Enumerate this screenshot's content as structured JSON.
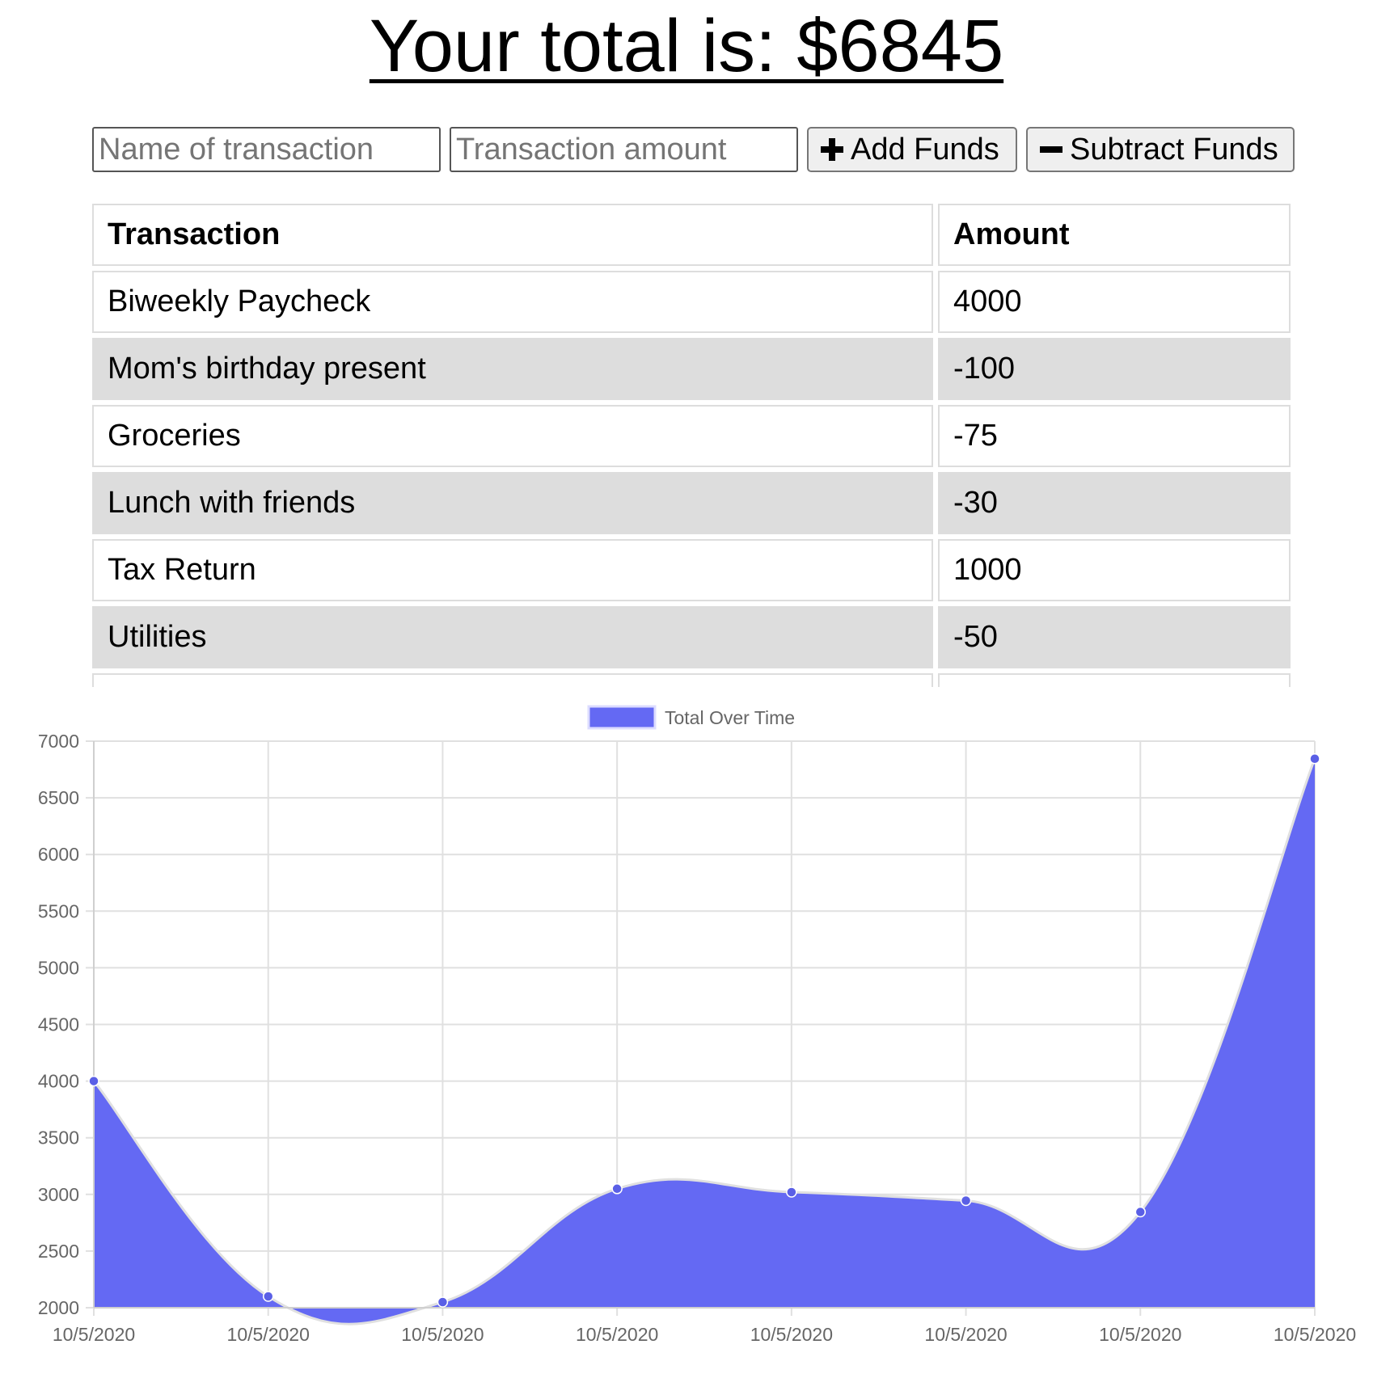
{
  "header": {
    "total_text": "Your total is: $6845"
  },
  "form": {
    "name_placeholder": "Name of transaction",
    "amount_placeholder": "Transaction amount",
    "add_label": "Add Funds",
    "subtract_label": "Subtract Funds"
  },
  "table": {
    "headers": [
      "Transaction",
      "Amount"
    ],
    "rows": [
      {
        "name": "Biweekly Paycheck",
        "amount": "4000"
      },
      {
        "name": "Mom's birthday present",
        "amount": "-100"
      },
      {
        "name": "Groceries",
        "amount": "-75"
      },
      {
        "name": "Lunch with friends",
        "amount": "-30"
      },
      {
        "name": "Tax Return",
        "amount": "1000"
      },
      {
        "name": "Utilities",
        "amount": "-50"
      },
      {
        "name": "",
        "amount": ""
      }
    ]
  },
  "colors": {
    "series_fill": "#6469f3",
    "series_point": "#5a5fe6",
    "series_line": "#e0e0e0",
    "grid": "#e0e0e0",
    "alt_row": "#dddddd"
  },
  "chart_data": {
    "type": "area",
    "legend": "top",
    "grid": true,
    "categories": [
      "10/5/2020",
      "10/5/2020",
      "10/5/2020",
      "10/5/2020",
      "10/5/2020",
      "10/5/2020",
      "10/5/2020",
      "10/5/2020"
    ],
    "series": [
      {
        "name": "Total Over Time",
        "values": [
          4000,
          2100,
          2050,
          3050,
          3020,
          2945,
          2845,
          6845
        ]
      }
    ],
    "ylim": [
      2000,
      7000
    ],
    "yticks": [
      2000,
      2500,
      3000,
      3500,
      4000,
      4500,
      5000,
      5500,
      6000,
      6500,
      7000
    ]
  }
}
